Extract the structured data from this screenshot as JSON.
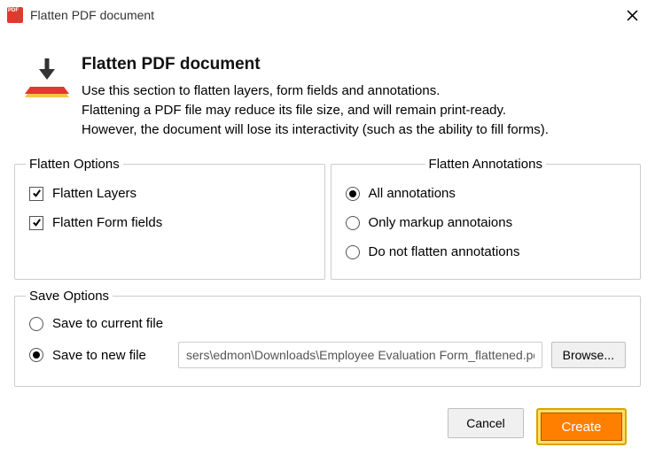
{
  "window": {
    "title": "Flatten PDF document"
  },
  "header": {
    "title": "Flatten PDF document",
    "line1": "Use this section to flatten layers, form fields and annotations.",
    "line2": "Flattening a PDF file may reduce its file size, and will remain print-ready.",
    "line3": "However, the document will lose its interactivity (such as the ability to fill forms)."
  },
  "flatten_options": {
    "legend": "Flatten Options",
    "layers": {
      "label": "Flatten Layers",
      "checked": true
    },
    "form_fields": {
      "label": "Flatten Form fields",
      "checked": true
    }
  },
  "flatten_annotations": {
    "legend": "Flatten Annotations",
    "selected": "all",
    "items": {
      "all": "All annotations",
      "markup": "Only markup annotaions",
      "none": "Do not flatten annotations"
    }
  },
  "save_options": {
    "legend": "Save Options",
    "selected": "new",
    "current_label": "Save to current file",
    "new_label": "Save to new file",
    "path": "sers\\edmon\\Downloads\\Employee Evaluation Form_flattened.pdf",
    "browse_label": "Browse..."
  },
  "footer": {
    "cancel": "Cancel",
    "create": "Create"
  }
}
